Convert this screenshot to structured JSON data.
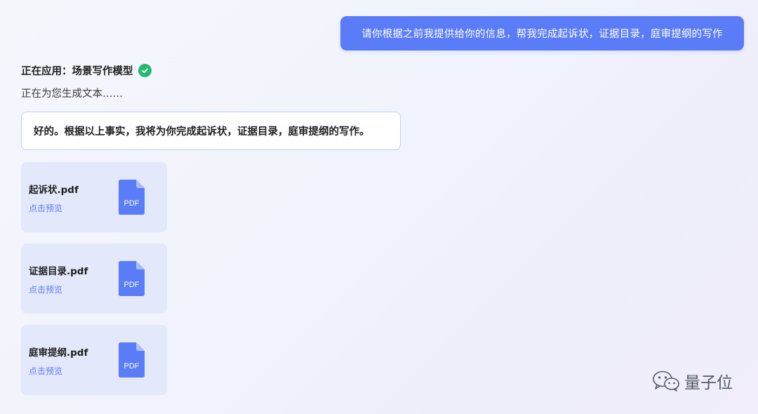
{
  "user_message": "请你根据之前我提供给你的信息，帮我完成起诉状，证据目录，庭审提纲的写作",
  "status": {
    "label": "正在应用：场景写作模型",
    "check_icon": "check-circle-icon",
    "check_color": "#28b86f"
  },
  "generating_text": "正在为您生成文本……",
  "assistant_reply": "好的。根据以上事实，我将为你完成起诉状，证据目录，庭审提纲的写作。",
  "files": [
    {
      "name": "起诉状.pdf",
      "preview": "点击预览",
      "icon": "pdf-file-icon",
      "icon_text": "PDF"
    },
    {
      "name": "证据目录.pdf",
      "preview": "点击预览",
      "icon": "pdf-file-icon",
      "icon_text": "PDF"
    },
    {
      "name": "庭审提纲.pdf",
      "preview": "点击预览",
      "icon": "pdf-file-icon",
      "icon_text": "PDF"
    }
  ],
  "watermark": {
    "icon": "wechat-icon",
    "text": "量子位"
  },
  "colors": {
    "accent": "#5b7cf7",
    "file_card_bg": "#e3e9fb",
    "reply_border": "#bcd0f0"
  }
}
